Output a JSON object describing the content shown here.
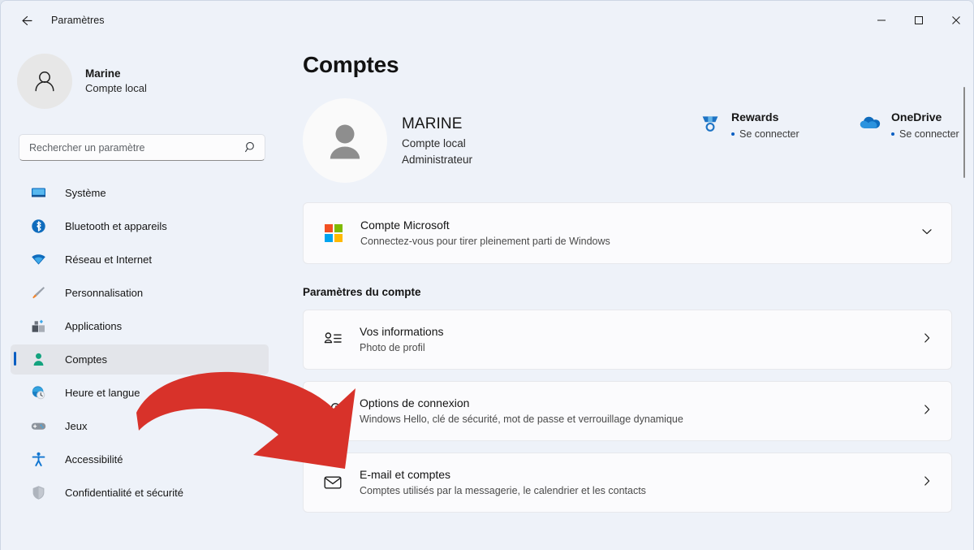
{
  "window": {
    "title": "Paramètres",
    "back_icon": "back-arrow-icon",
    "minimize_label": "—",
    "maximize_label": "▢",
    "close_label": "✕"
  },
  "sidebar": {
    "profile": {
      "name": "Marine",
      "subtitle": "Compte local",
      "avatar_icon": "person-icon"
    },
    "search": {
      "placeholder": "Rechercher un paramètre",
      "value": "",
      "icon": "search-icon"
    },
    "items": [
      {
        "label": "Système",
        "icon": "monitor-icon",
        "active": false
      },
      {
        "label": "Bluetooth et appareils",
        "icon": "bluetooth-icon",
        "active": false
      },
      {
        "label": "Réseau et Internet",
        "icon": "wifi-icon",
        "active": false
      },
      {
        "label": "Personnalisation",
        "icon": "paintbrush-icon",
        "active": false
      },
      {
        "label": "Applications",
        "icon": "apps-icon",
        "active": false
      },
      {
        "label": "Comptes",
        "icon": "accounts-person-icon",
        "active": true
      },
      {
        "label": "Heure et langue",
        "icon": "clock-globe-icon",
        "active": false
      },
      {
        "label": "Jeux",
        "icon": "gamepad-icon",
        "active": false
      },
      {
        "label": "Accessibilité",
        "icon": "accessibility-person-icon",
        "active": false
      },
      {
        "label": "Confidentialité et sécurité",
        "icon": "shield-icon",
        "active": false
      }
    ]
  },
  "main": {
    "page_title": "Comptes",
    "hero": {
      "avatar_icon": "person-icon",
      "name": "MARINE",
      "line1": "Compte local",
      "line2": "Administrateur"
    },
    "hero_links": [
      {
        "title": "Rewards",
        "action": "Se connecter",
        "icon": "rewards-medal-icon"
      },
      {
        "title": "OneDrive",
        "action": "Se connecter",
        "icon": "onedrive-cloud-icon"
      }
    ],
    "microsoft_card": {
      "title": "Compte Microsoft",
      "subtitle": "Connectez-vous pour tirer pleinement parti de Windows",
      "icon": "microsoft-logo-icon",
      "expand_icon": "chevron-down-icon"
    },
    "section_heading": "Paramètres du compte",
    "settings_rows": [
      {
        "title": "Vos informations",
        "subtitle": "Photo de profil",
        "icon": "user-info-icon",
        "chevron": "chevron-right-icon"
      },
      {
        "title": "Options de connexion",
        "subtitle": "Windows Hello, clé de sécurité, mot de passe et verrouillage dynamique",
        "icon": "key-icon",
        "chevron": "chevron-right-icon"
      },
      {
        "title": "E-mail et comptes",
        "subtitle": "Comptes utilisés par la messagerie, le calendrier et les contacts",
        "icon": "envelope-icon",
        "chevron": "chevron-right-icon"
      }
    ]
  },
  "annotation": {
    "type": "curved-arrow",
    "color": "#d8322a",
    "points_to": "Options de connexion"
  },
  "colors": {
    "background": "#eef2f9",
    "card": "#fbfbfd",
    "accent": "#0a5ec2",
    "annotation_red": "#d8322a",
    "selected_nav": "#e3e5ea"
  }
}
